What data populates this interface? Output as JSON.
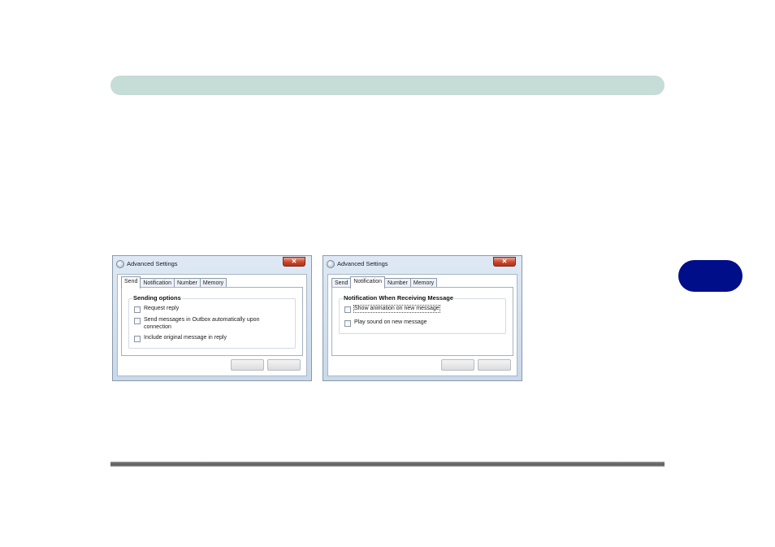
{
  "page": {
    "chapter_tab_color": "#000e8a",
    "header_bar_color": "#c5dcd7"
  },
  "dialogs": [
    {
      "title": "Advanced Settings",
      "icon": "app-icon",
      "close_glyph": "✕",
      "tabs": [
        "Send",
        "Notification",
        "Number",
        "Memory"
      ],
      "active_tab": "Send",
      "group_title": "Sending options",
      "options": [
        {
          "label": "Request reply",
          "checked": false
        },
        {
          "label": "Send messages in Outbox automatically upon",
          "label2": "connection",
          "checked": false
        },
        {
          "label": "Include original message in reply",
          "checked": false
        }
      ],
      "buttons": {
        "ok": "",
        "cancel": ""
      }
    },
    {
      "title": "Advanced Settings",
      "icon": "app-icon",
      "close_glyph": "✕",
      "tabs": [
        "Send",
        "Notification",
        "Number",
        "Memory"
      ],
      "active_tab": "Notification",
      "group_title": "Notification When Receiving Message",
      "options": [
        {
          "label": "Show animation on new message",
          "checked": false
        },
        {
          "label": "Play sound on new message",
          "checked": false
        }
      ],
      "buttons": {
        "ok": "",
        "cancel": ""
      }
    }
  ]
}
